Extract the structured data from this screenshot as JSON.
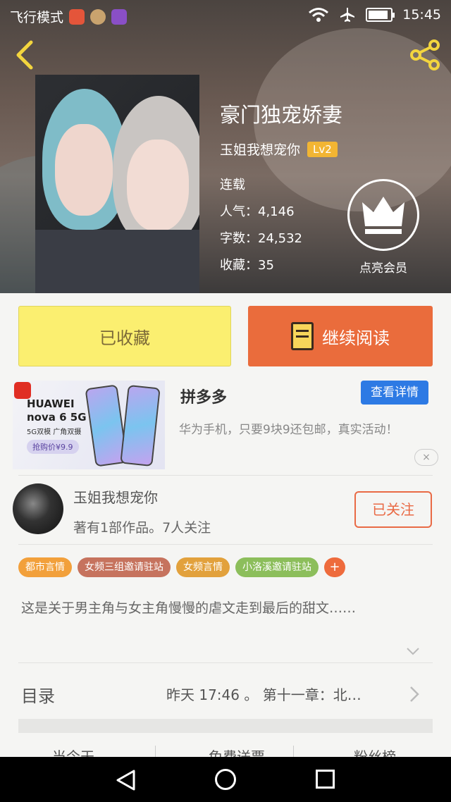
{
  "status_bar": {
    "carrier": "飞行模式",
    "time": "15:45",
    "battery_level": 0.9
  },
  "book": {
    "title": "豪门独宠娇妻",
    "author": "玉姐我想宠你",
    "level": "Lv2",
    "status": "连载",
    "popularity_label": "人气：4,146",
    "word_count_label": "字数：24,532",
    "collections_label": "收藏：35"
  },
  "vip": {
    "label": "点亮会员"
  },
  "actions": {
    "collect_label": "已收藏",
    "read_label": "继续阅读"
  },
  "ad": {
    "image_brand_line1": "HUAWEI",
    "image_brand_line2": "nova 6 5G",
    "image_sub": "5G双模  广角双摄",
    "image_price": "抢购价¥9.9",
    "title": "拼多多",
    "detail_button": "查看详情",
    "description": "华为手机，只要9块9还包邮，真实活动！",
    "close_icon": "×"
  },
  "author_card": {
    "name": "玉姐我想宠你",
    "stats": "著有1部作品。7人关注",
    "follow_label": "已关注"
  },
  "tags": [
    {
      "label": "都市言情",
      "color": "#f2a03b"
    },
    {
      "label": "女频三组邀请驻站",
      "color": "#c6735e"
    },
    {
      "label": "女频言情",
      "color": "#e2a13c"
    },
    {
      "label": "小洛溪邀请驻站",
      "color": "#8cbe5b"
    }
  ],
  "tag_add_label": "+",
  "description": "这是关于男主角与女主角慢慢的虐文走到最后的甜文……",
  "toc": {
    "label": "目录",
    "latest": "昨天 17:46 。 第十一章：北…"
  },
  "bottom_tabs": [
    "当今天",
    "免费送票",
    "粉丝榜"
  ],
  "colors": {
    "accent_orange": "#ea6c3c",
    "collect_yellow": "#fbef70",
    "level_badge": "#f2b533",
    "ad_button_blue": "#2d7ae4"
  }
}
